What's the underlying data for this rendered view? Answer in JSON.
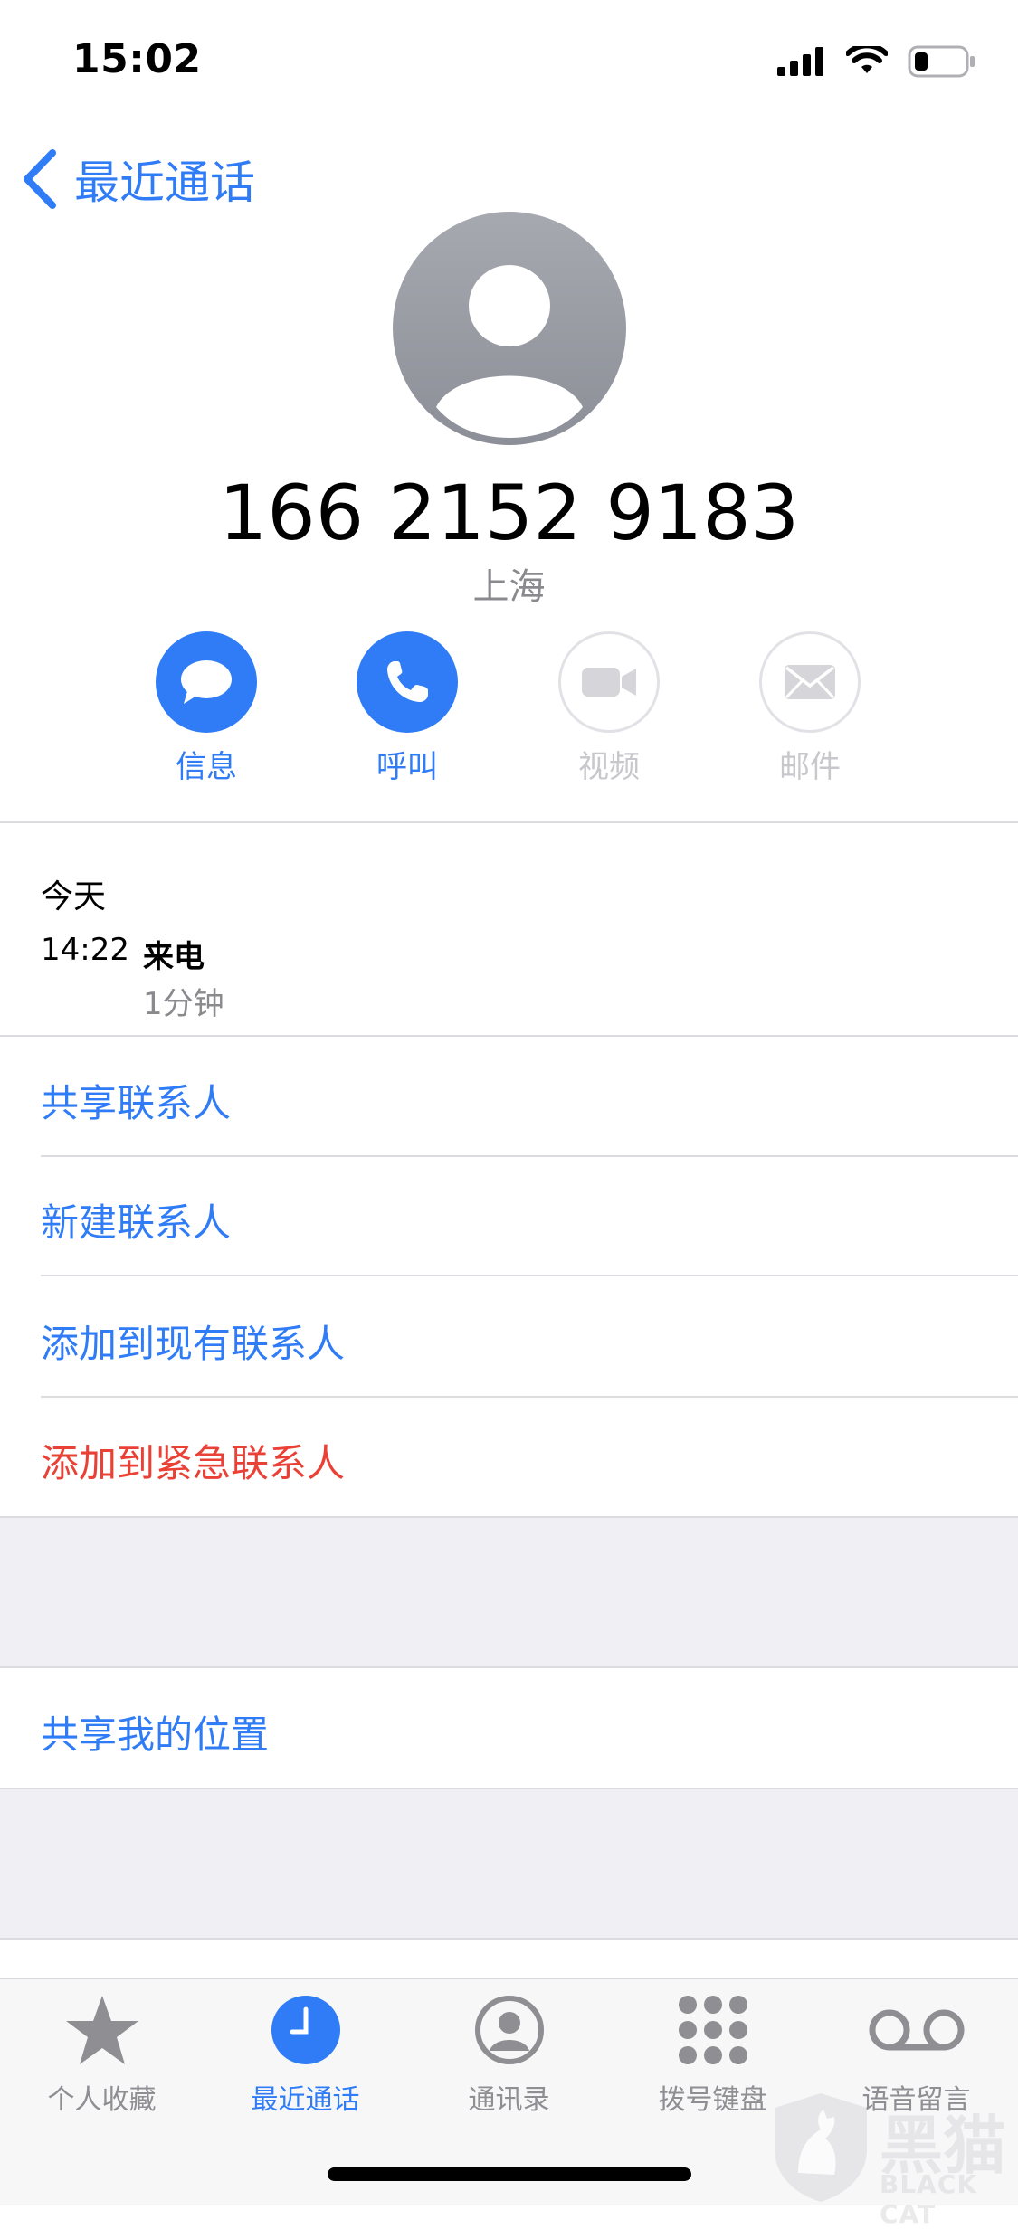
{
  "status": {
    "time": "15:02"
  },
  "nav": {
    "back_label": "最近通话"
  },
  "contact": {
    "number": "166 2152 9183",
    "location": "上海"
  },
  "actions": [
    {
      "label": "信息",
      "icon": "message-icon",
      "enabled": true
    },
    {
      "label": "呼叫",
      "icon": "phone-icon",
      "enabled": true
    },
    {
      "label": "视频",
      "icon": "video-icon",
      "enabled": false
    },
    {
      "label": "邮件",
      "icon": "mail-icon",
      "enabled": false
    }
  ],
  "history": {
    "day": "今天",
    "time": "14:22",
    "type": "来电",
    "duration": "1分钟"
  },
  "options": [
    "共享联系人",
    "新建联系人",
    "添加到现有联系人",
    "添加到紧急联系人"
  ],
  "location_share": "共享我的位置",
  "tabs": [
    {
      "label": "个人收藏",
      "icon": "star-icon",
      "active": false
    },
    {
      "label": "最近通话",
      "icon": "clock-icon",
      "active": true
    },
    {
      "label": "通讯录",
      "icon": "contacts-icon",
      "active": false
    },
    {
      "label": "拨号键盘",
      "icon": "keypad-icon",
      "active": false
    },
    {
      "label": "语音留言",
      "icon": "voicemail-icon",
      "active": false
    }
  ],
  "watermark": {
    "cn": "黑猫",
    "en": "BLACK CAT"
  },
  "colors": {
    "accent": "#2f7cf6",
    "destructive": "#ea4136",
    "gray_band": "#efeff4"
  }
}
